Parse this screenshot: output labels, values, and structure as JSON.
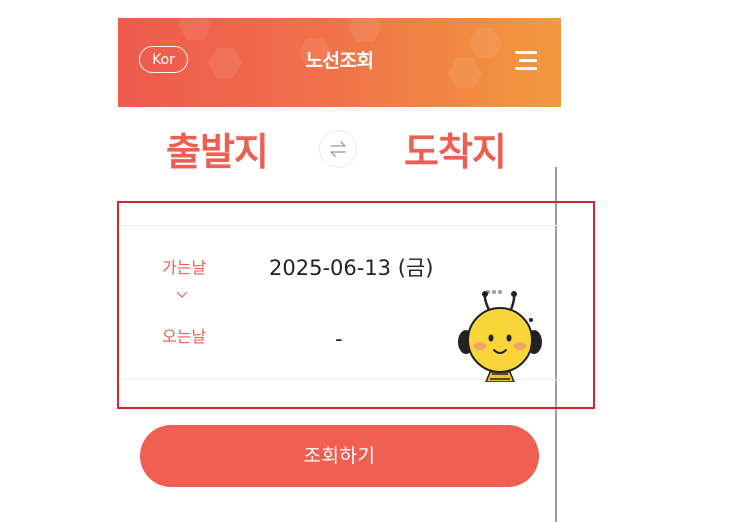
{
  "header": {
    "language_label": "Kor",
    "title": "노선조회",
    "menu_icon": "hamburger-menu-icon"
  },
  "route": {
    "departure_label": "출발지",
    "arrival_label": "도착지",
    "swap_icon": "swap-arrows-icon"
  },
  "dates": {
    "go_label": "가는날",
    "go_value": "2025-06-13 (금)",
    "return_label": "오는날",
    "return_value": "-",
    "toggle_icon": "chevron-down-icon"
  },
  "mascot": {
    "icon": "bee-mascot-icon"
  },
  "search_button": {
    "label": "조회하기"
  },
  "colors": {
    "accent": "#ec5f52",
    "header_gradient_start": "#ee5a4d",
    "header_gradient_end": "#f29a3e",
    "highlight_border": "#d9232c"
  }
}
